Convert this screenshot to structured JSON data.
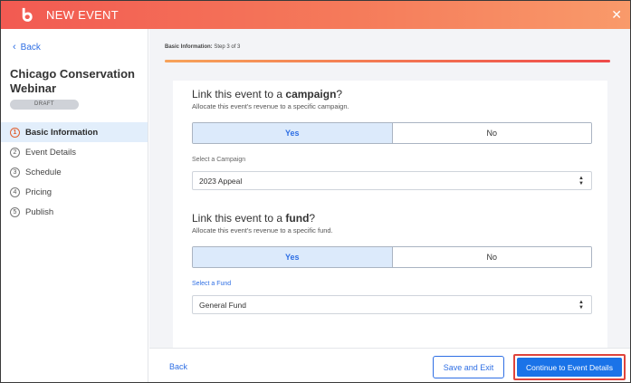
{
  "header": {
    "title": "NEW EVENT",
    "close_glyph": "✕"
  },
  "sidebar": {
    "back_label": "Back",
    "event_name": "Chicago Conservation Webinar",
    "status_badge": "DRAFT",
    "steps": [
      {
        "num": "1",
        "label": "Basic Information",
        "active": true
      },
      {
        "num": "2",
        "label": "Event Details",
        "active": false
      },
      {
        "num": "3",
        "label": "Schedule",
        "active": false
      },
      {
        "num": "4",
        "label": "Pricing",
        "active": false
      },
      {
        "num": "5",
        "label": "Publish",
        "active": false
      }
    ]
  },
  "main": {
    "step_caption_bold": "Basic Information:",
    "step_caption_rest": " Step 3 of 3",
    "progress": 1.0,
    "campaign": {
      "title_prefix": "Link this event to a ",
      "title_bold": "campaign",
      "title_suffix": "?",
      "subtitle": "Allocate this event's revenue to a specific campaign.",
      "yes_label": "Yes",
      "no_label": "No",
      "selected": "yes",
      "field_label": "Select a Campaign",
      "field_value": "2023 Appeal"
    },
    "fund": {
      "title_prefix": "Link this event to a ",
      "title_bold": "fund",
      "title_suffix": "?",
      "subtitle": "Allocate this event's revenue to a specific fund.",
      "yes_label": "Yes",
      "no_label": "No",
      "selected": "yes",
      "field_label": "Select a Fund",
      "field_value": "General Fund"
    }
  },
  "footer": {
    "back_label": "Back",
    "save_exit_label": "Save and Exit",
    "continue_label": "Continue to Event Details"
  },
  "colors": {
    "header_start": "#f25a52",
    "header_end": "#f99a6a",
    "accent_blue": "#1a73e8",
    "link_blue": "#2f6fe4",
    "highlight_red": "#e0443c"
  },
  "icons": {
    "logo": "brand-logo-icon",
    "close": "close-icon",
    "back": "chevron-left-icon",
    "select_arrow": "sort-arrows-icon"
  }
}
